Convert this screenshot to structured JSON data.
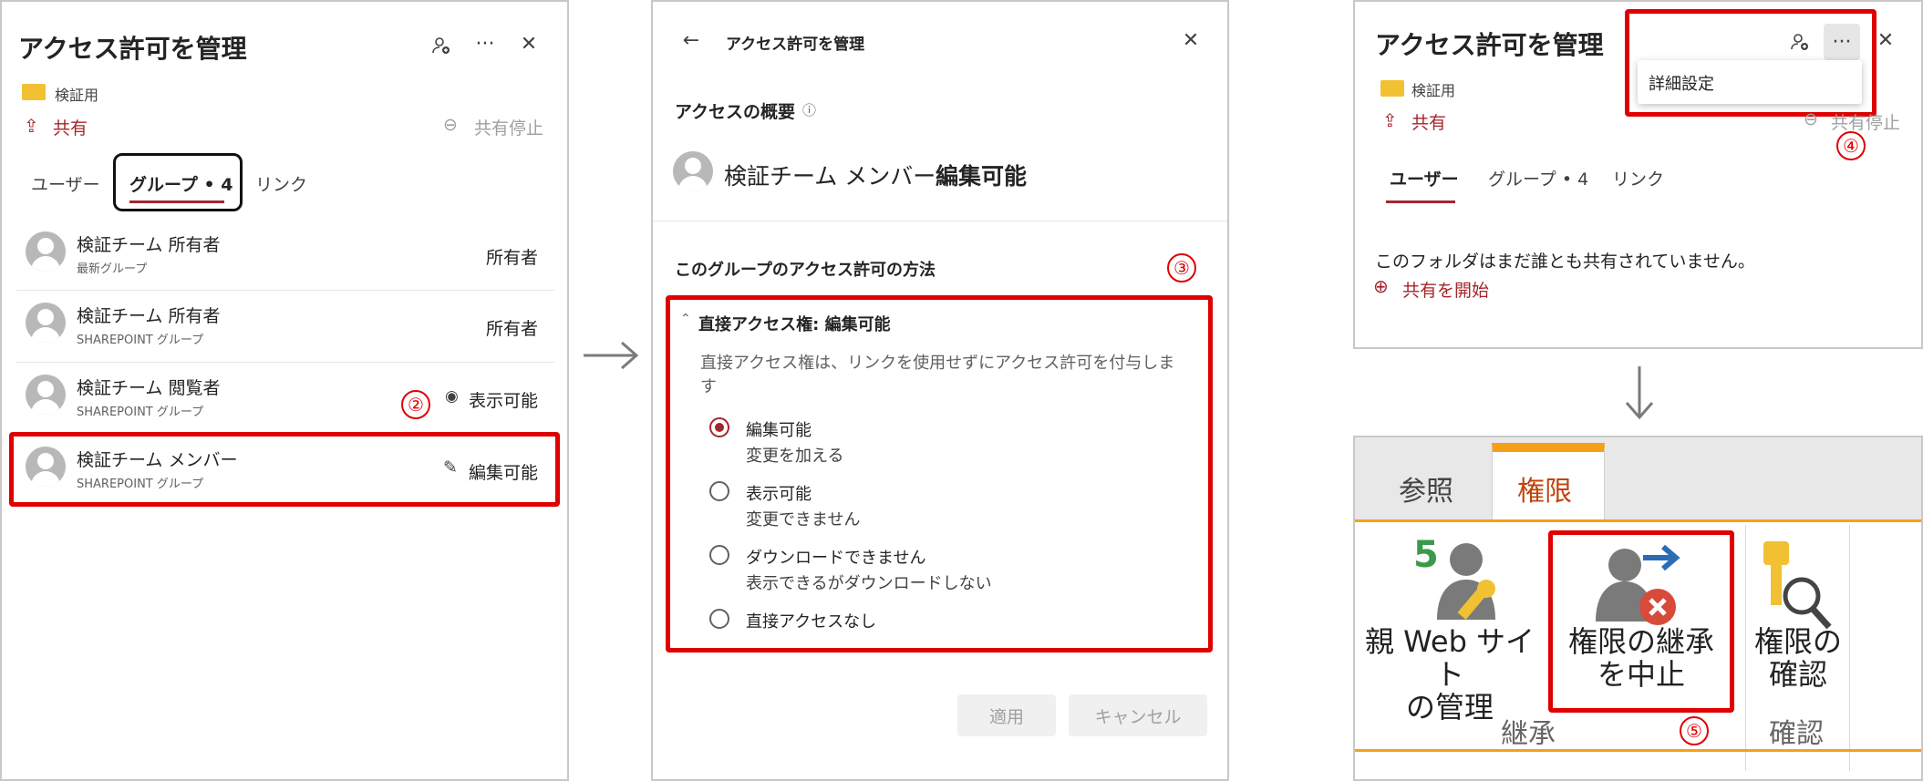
{
  "panel1": {
    "title": "アクセス許可を管理",
    "folder_name": "検証用",
    "share_label": "共有",
    "stop_share_label": "共有停止",
    "tabs": [
      "ユーザー",
      "グループ • 4",
      "リンク"
    ],
    "groups": [
      {
        "name": "検証チーム 所有者",
        "sub": "最新グループ",
        "perm": "所有者",
        "perm_icon": ""
      },
      {
        "name": "検証チーム 所有者",
        "sub": "SHAREPOINT グループ",
        "perm": "所有者",
        "perm_icon": ""
      },
      {
        "name": "検証チーム 閲覧者",
        "sub": "SHAREPOINT グループ",
        "perm": "表示可能",
        "perm_icon": "eye-icon"
      },
      {
        "name": "検証チーム メンバー",
        "sub": "SHAREPOINT グループ",
        "perm": "編集可能",
        "perm_icon": "pencil-icon"
      }
    ],
    "step_label": "②"
  },
  "panel2": {
    "title": "アクセス許可を管理",
    "overview_label": "アクセスの概要",
    "member_name": "検証チーム メンバー",
    "member_perm": "編集可能",
    "method_heading": "このグループのアクセス許可の方法",
    "step_label": "③",
    "direct_heading": "直接アクセス権: 編集可能",
    "direct_desc_1": "直接アクセス権は、リンクを使用せずにアクセス許可を付与しま",
    "direct_desc_2": "す",
    "options": [
      {
        "label": "編集可能",
        "sub": "変更を加える",
        "selected": true
      },
      {
        "label": "表示可能",
        "sub": "変更できません",
        "selected": false
      },
      {
        "label": "ダウンロードできません",
        "sub": "表示できるがダウンロードしない",
        "selected": false
      },
      {
        "label": "直接アクセスなし",
        "sub": "",
        "selected": false
      }
    ],
    "apply_label": "適用",
    "cancel_label": "キャンセル"
  },
  "panel3": {
    "title": "アクセス許可を管理",
    "folder_name": "検証用",
    "share_label": "共有",
    "stop_share_label": "共有停止",
    "menu_item": "詳細設定",
    "step_label": "④",
    "tabs": [
      "ユーザー",
      "グループ • 4",
      "リンク"
    ],
    "empty_text": "このフォルダはまだ誰とも共有されていません。",
    "start_share_label": "共有を開始"
  },
  "panel4": {
    "tabs": [
      "参照",
      "権限"
    ],
    "buttons": [
      {
        "label": "親 Web サイト\nの管理",
        "icon": "parent-site-icon"
      },
      {
        "label": "権限の継承\nを中止",
        "icon": "stop-inherit-icon"
      },
      {
        "label": "権限の\n確認",
        "icon": "check-permission-icon"
      }
    ],
    "group_labels": [
      "継承",
      "確認"
    ],
    "step_label": "⑤"
  },
  "colors": {
    "accent_red": "#a4262c",
    "highlight_red": "#e00000",
    "ribbon_orange": "#f6a01a"
  }
}
